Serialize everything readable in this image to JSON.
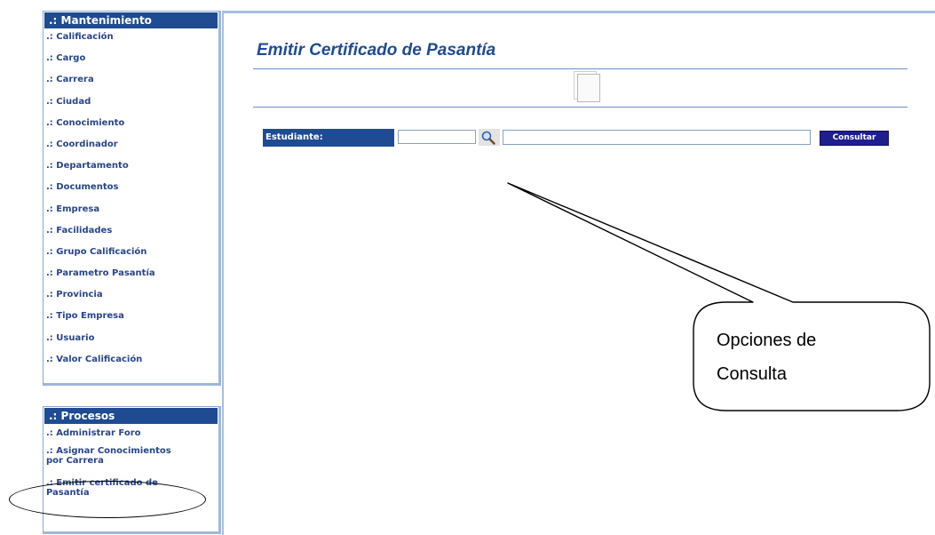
{
  "sidebar": {
    "mantenimiento": {
      "title": ".: Mantenimiento",
      "items": [
        ".: Calificación",
        ".: Cargo",
        ".: Carrera",
        ".: Ciudad",
        ".: Conocimiento",
        ".: Coordinador",
        ".: Departamento",
        ".: Documentos",
        ".: Empresa",
        ".: Facilidades",
        ".: Grupo Calificación",
        ".: Parametro Pasantía",
        ".: Provincia",
        ".: Tipo Empresa",
        ".: Usuario",
        ".: Valor Calificación"
      ]
    },
    "procesos": {
      "title": ".: Procesos",
      "items": [
        ".: Administrar Foro",
        ".: Asignar Conocimientos por Carrera",
        ".: Emitir certificado de Pasantía"
      ]
    }
  },
  "main": {
    "title": "Emitir Certificado de Pasantía",
    "form": {
      "label": "Estudiante:",
      "code_value": "",
      "name_value": "",
      "consult_label": "Consultar"
    }
  },
  "callout": {
    "line1": "Opciones de",
    "line2": "Consulta"
  },
  "colors": {
    "header_blue": "#1e4b92",
    "button_blue": "#1e1e8f"
  }
}
